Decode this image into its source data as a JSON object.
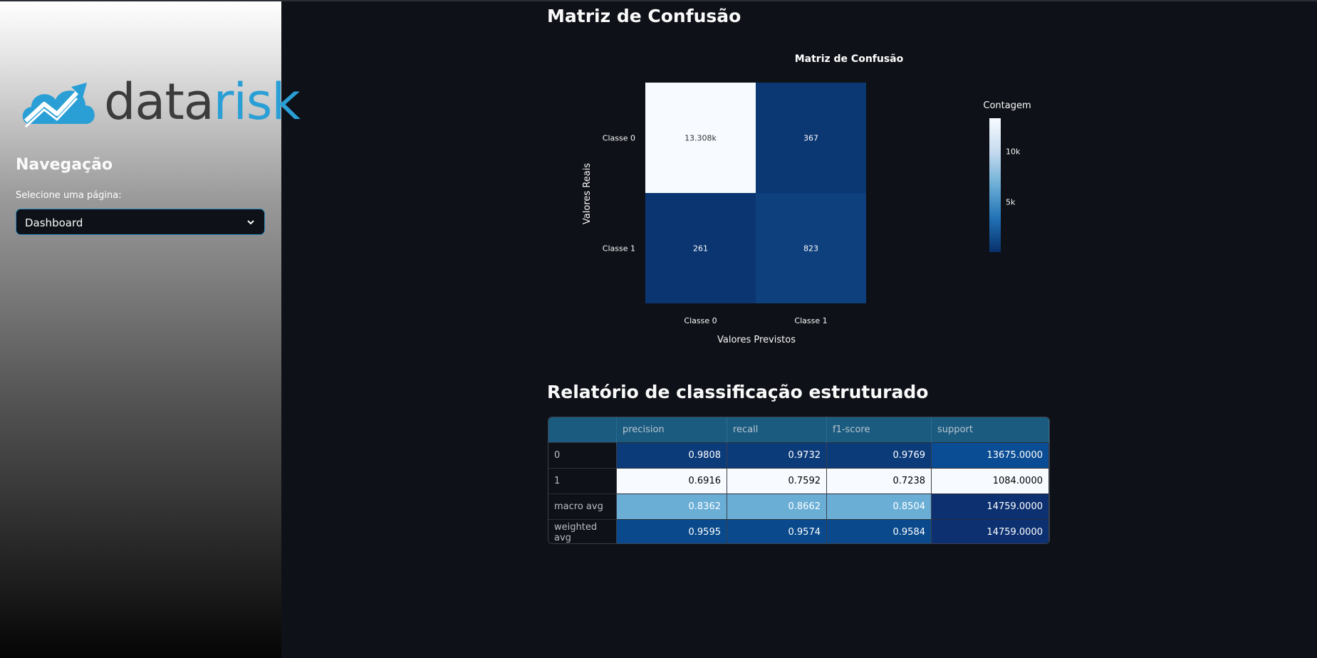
{
  "sidebar": {
    "logo": {
      "part1": "data",
      "part2": "risk"
    },
    "nav_title": "Navegação",
    "select_label": "Selecione uma página:",
    "selected_page": "Dashboard",
    "colors": {
      "accent": "#2e8bc0",
      "logo_blue": "#2a9fd6"
    }
  },
  "main": {
    "section1_title": "Matriz de Confusão",
    "section2_title": "Relatório de classificação estruturado"
  },
  "chart_data": {
    "type": "heatmap",
    "title": "Matriz de Confusão",
    "xlabel": "Valores Previstos",
    "ylabel": "Valores Reais",
    "x_categories": [
      "Classe 0",
      "Classe 1"
    ],
    "y_categories": [
      "Classe 0",
      "Classe 1"
    ],
    "values": [
      [
        13308,
        367
      ],
      [
        261,
        823
      ]
    ],
    "labels": [
      [
        "13.308k",
        "367"
      ],
      [
        "261",
        "823"
      ]
    ],
    "colorbar": {
      "title": "Contagem",
      "ticks": [
        "10k",
        "5k"
      ],
      "tick_values": [
        10000,
        5000
      ],
      "range": [
        0,
        13308
      ]
    },
    "colorscale": "Blues"
  },
  "report": {
    "columns": [
      "",
      "precision",
      "recall",
      "f1-score",
      "support"
    ],
    "rows": [
      {
        "label": "0",
        "values": [
          "0.9808",
          "0.9732",
          "0.9769",
          "13675.0000"
        ],
        "bg": [
          "#0c3b7a",
          "#0c3b7a",
          "#0c3b7a",
          "#0a4d94"
        ],
        "fg": [
          "#ffffff",
          "#ffffff",
          "#ffffff",
          "#ffffff"
        ]
      },
      {
        "label": "1",
        "values": [
          "0.6916",
          "0.7592",
          "0.7238",
          "1084.0000"
        ],
        "bg": [
          "#f7fbff",
          "#f7fbff",
          "#f7fbff",
          "#f7fbff"
        ],
        "fg": [
          "#000000",
          "#000000",
          "#000000",
          "#000000"
        ]
      },
      {
        "label": "macro avg",
        "values": [
          "0.8362",
          "0.8662",
          "0.8504",
          "14759.0000"
        ],
        "bg": [
          "#6aaed6",
          "#6aaed6",
          "#6aaed6",
          "#0c3070"
        ],
        "fg": [
          "#ffffff",
          "#ffffff",
          "#ffffff",
          "#ffffff"
        ]
      },
      {
        "label": "weighted avg",
        "values": [
          "0.9595",
          "0.9574",
          "0.9584",
          "14759.0000"
        ],
        "bg": [
          "#0a4a8c",
          "#0a4a8c",
          "#0a4a8c",
          "#0c3070"
        ],
        "fg": [
          "#ffffff",
          "#ffffff",
          "#ffffff",
          "#ffffff"
        ]
      }
    ]
  }
}
